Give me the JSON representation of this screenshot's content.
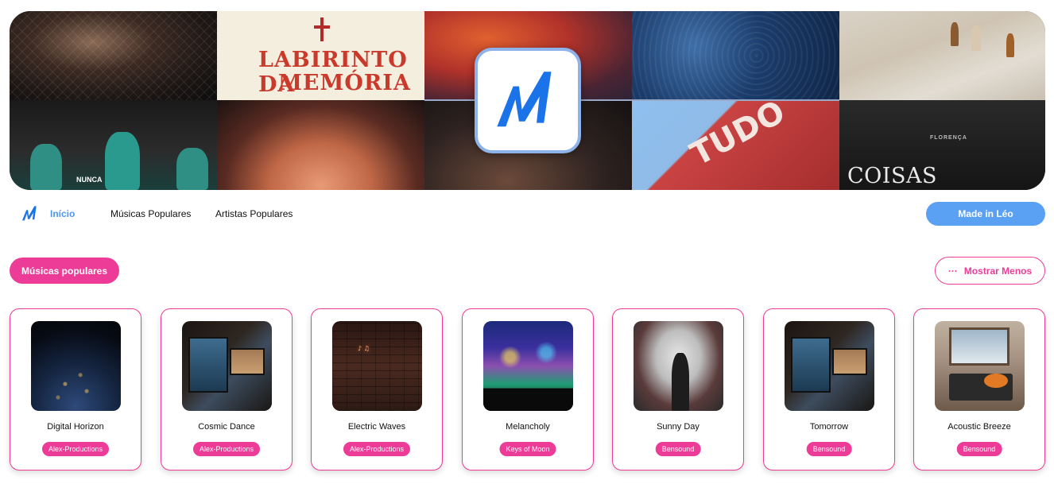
{
  "banner": {
    "tiles": [
      {
        "id": "album-1",
        "text": ""
      },
      {
        "id": "album-labirinto",
        "line1": "LABIRINTO DA",
        "line2": "MEMÓRIA"
      },
      {
        "id": "album-3",
        "text": ""
      },
      {
        "id": "album-4",
        "text": ""
      },
      {
        "id": "album-5",
        "text": ""
      },
      {
        "id": "album-nunca",
        "text": "NUNCA"
      },
      {
        "id": "album-7",
        "text": ""
      },
      {
        "id": "album-8",
        "text": ""
      },
      {
        "id": "album-tudo",
        "text": "TUDO"
      },
      {
        "id": "album-coisas",
        "small": "FLORENÇA",
        "text": "COISAS ESTRANHAS"
      }
    ],
    "logo_color": "#1a73e8"
  },
  "nav": {
    "home": "Início",
    "musicas": "Músicas Populares",
    "artistas": "Artistas Populares",
    "made_in": "Made in Léo"
  },
  "section": {
    "title": "Músicas populares",
    "toggle_label": "Mostrar Menos",
    "toggle_icon": "dots-icon"
  },
  "songs": [
    {
      "title": "Digital Horizon",
      "artist": "Alex-Productions"
    },
    {
      "title": "Cosmic Dance",
      "artist": "Alex-Productions"
    },
    {
      "title": "Electric Waves",
      "artist": "Alex-Productions"
    },
    {
      "title": "Melancholy",
      "artist": "Keys of Moon"
    },
    {
      "title": "Sunny Day",
      "artist": "Bensound"
    },
    {
      "title": "Tomorrow",
      "artist": "Bensound"
    },
    {
      "title": "Acoustic Breeze",
      "artist": "Bensound"
    }
  ],
  "colors": {
    "accent_pink": "#ec3c97",
    "accent_blue": "#5aa1f3",
    "nav_active": "#4e95f0"
  }
}
